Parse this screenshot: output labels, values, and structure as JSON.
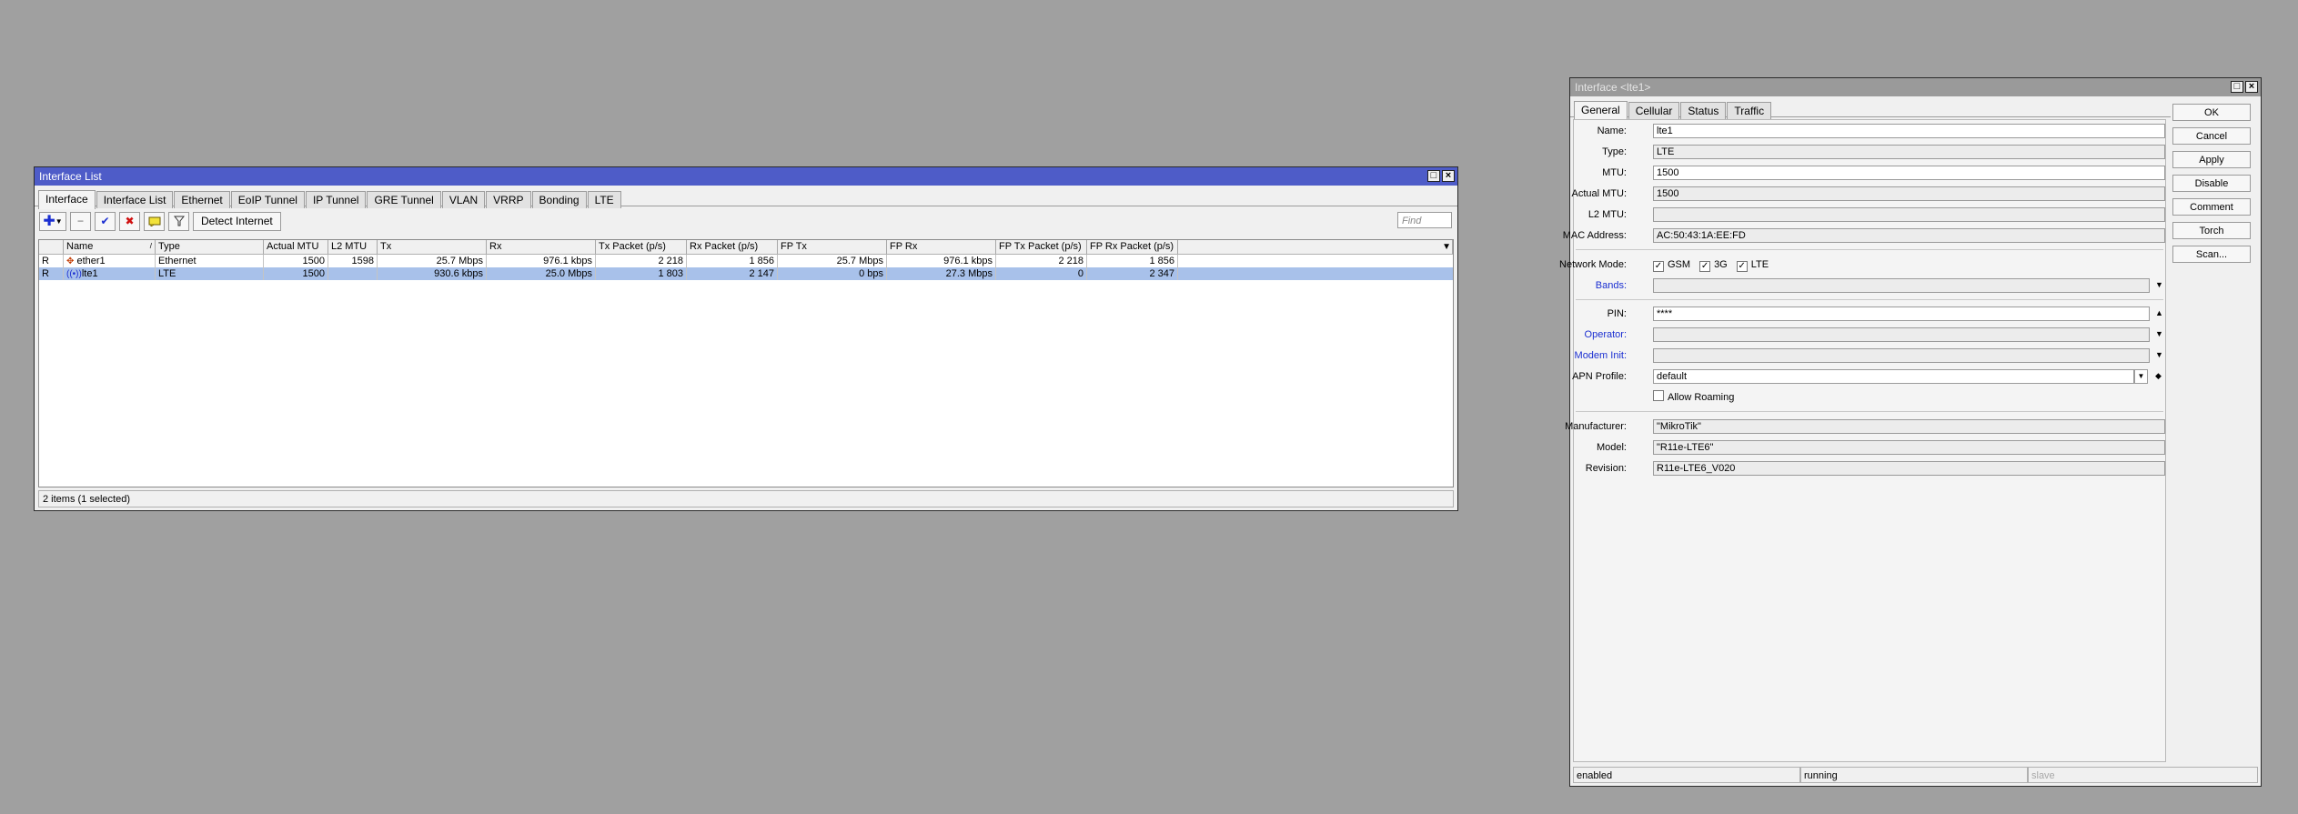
{
  "interface_list": {
    "title": "Interface List",
    "tabs": [
      "Interface",
      "Interface List",
      "Ethernet",
      "EoIP Tunnel",
      "IP Tunnel",
      "GRE Tunnel",
      "VLAN",
      "VRRP",
      "Bonding",
      "LTE"
    ],
    "toolbar": {
      "detect_label": "Detect Internet",
      "find_placeholder": "Find"
    },
    "columns": [
      "",
      "Name",
      "Type",
      "Actual MTU",
      "L2 MTU",
      "Tx",
      "Rx",
      "Tx Packet (p/s)",
      "Rx Packet (p/s)",
      "FP Tx",
      "FP Rx",
      "FP Tx Packet (p/s)",
      "FP Rx Packet (p/s)"
    ],
    "rows": [
      {
        "flag": "R",
        "name": "ether1",
        "type": "Ethernet",
        "actual_mtu": "1500",
        "l2_mtu": "1598",
        "tx": "25.7 Mbps",
        "rx": "976.1 kbps",
        "tx_pkt": "2 218",
        "rx_pkt": "1 856",
        "fp_tx": "25.7 Mbps",
        "fp_rx": "976.1 kbps",
        "fp_tx_pkt": "2 218",
        "fp_rx_pkt": "1 856"
      },
      {
        "flag": "R",
        "name": "lte1",
        "type": "LTE",
        "actual_mtu": "1500",
        "l2_mtu": "",
        "tx": "930.6 kbps",
        "rx": "25.0 Mbps",
        "tx_pkt": "1 803",
        "rx_pkt": "2 147",
        "fp_tx": "0 bps",
        "fp_rx": "27.3 Mbps",
        "fp_tx_pkt": "0",
        "fp_rx_pkt": "2 347"
      }
    ],
    "status": "2 items (1 selected)"
  },
  "interface_dialog": {
    "title": "Interface <lte1>",
    "tabs": [
      "General",
      "Cellular",
      "Status",
      "Traffic"
    ],
    "labels": {
      "name": "Name:",
      "type": "Type:",
      "mtu": "MTU:",
      "actual_mtu": "Actual MTU:",
      "l2_mtu": "L2 MTU:",
      "mac": "MAC Address:",
      "network_mode": "Network Mode:",
      "bands": "Bands:",
      "pin": "PIN:",
      "operator": "Operator:",
      "modem_init": "Modem Init:",
      "apn_profile": "APN Profile:",
      "manufacturer": "Manufacturer:",
      "model": "Model:",
      "revision": "Revision:"
    },
    "values": {
      "name": "lte1",
      "type": "LTE",
      "mtu": "1500",
      "actual_mtu": "1500",
      "l2_mtu": "",
      "mac": "AC:50:43:1A:EE:FD",
      "bands": "",
      "pin": "****",
      "operator": "",
      "modem_init": "",
      "apn_profile": "default",
      "manufacturer": "\"MikroTik\"",
      "model": "\"R11e-LTE6\"",
      "revision": "R11e-LTE6_V020"
    },
    "network_modes": [
      "GSM",
      "3G",
      "LTE"
    ],
    "allow_roaming": "Allow Roaming",
    "buttons": [
      "OK",
      "Cancel",
      "Apply",
      "Disable",
      "Comment",
      "Torch",
      "Scan..."
    ],
    "status": [
      "enabled",
      "running",
      "slave"
    ]
  },
  "colors": {
    "desktop": "#a0a0a0",
    "active_title": "#4e5cc8",
    "selected_row": "#a8c1ea",
    "link_label": "#1b2fd1"
  }
}
